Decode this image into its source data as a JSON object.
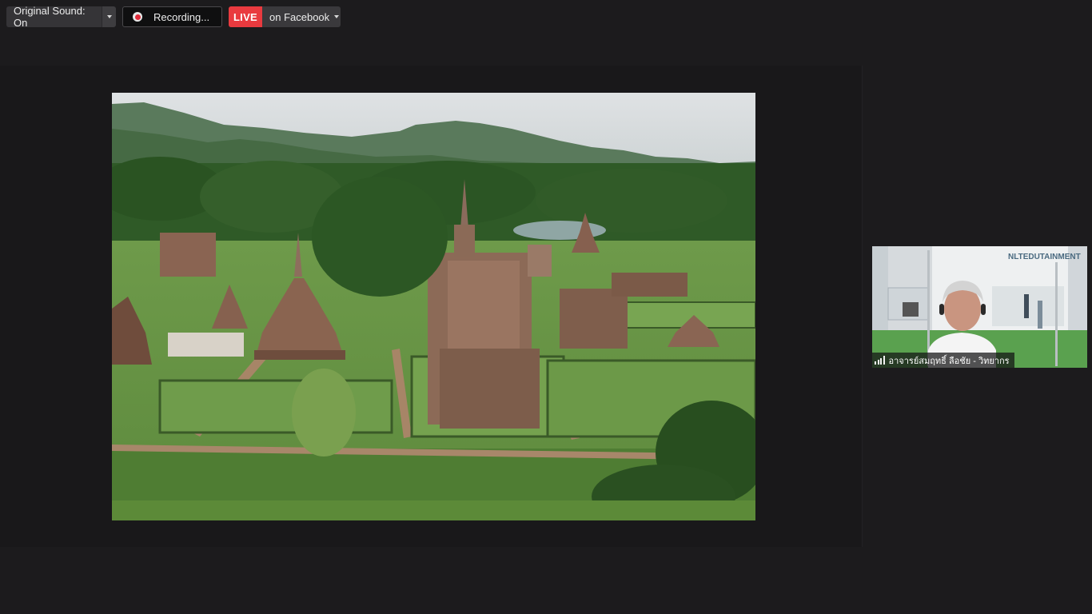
{
  "toolbar": {
    "original_sound_label": "Original Sound: On",
    "original_sound_menu_icon": "chevron-down-icon",
    "recording_label": "Recording...",
    "recording_icon": "record-icon",
    "live_badge": "LIVE",
    "live_destination": "on Facebook",
    "live_menu_icon": "chevron-down-icon"
  },
  "shared_screen": {
    "content": "aerial-photo-historical-park"
  },
  "participant": {
    "name": "อาจารย์สมฤทธิ์ ลือชัย - วิทยากร",
    "signal_icon": "signal-strength-icon",
    "background_sign_text": "NLTEDUTAINMENT"
  },
  "colors": {
    "background": "#1c1b1d",
    "live_red": "#e93a3f",
    "record_red": "#e02b3a"
  }
}
